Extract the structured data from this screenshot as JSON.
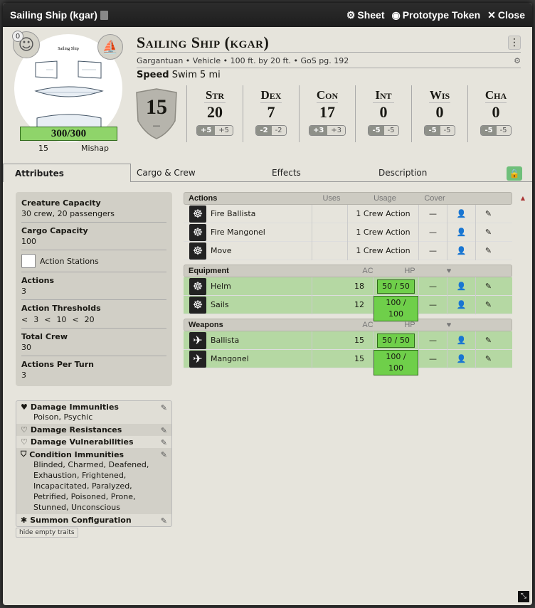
{
  "window": {
    "title": "Sailing Ship (kgar)",
    "sheet": "Sheet",
    "prototype": "Prototype Token",
    "close": "Close"
  },
  "portrait": {
    "token_count": "0",
    "hp": "300/300",
    "hp_sub": "15",
    "mishap": "Mishap",
    "plan_title": "Sailing Ship"
  },
  "header": {
    "name": "Sailing Ship (kgar)",
    "subtitle": "Gargantuan • Vehicle • 100 ft. by 20 ft. • GoS pg. 192",
    "speed_label": "Speed",
    "speed_value": "Swim 5 mi",
    "ac": "15",
    "ac_sub": "—"
  },
  "abilities": [
    {
      "abbr": "Str",
      "score": "20",
      "mod": "+5",
      "save": "+5"
    },
    {
      "abbr": "Dex",
      "score": "7",
      "mod": "-2",
      "save": "-2"
    },
    {
      "abbr": "Con",
      "score": "17",
      "mod": "+3",
      "save": "+3"
    },
    {
      "abbr": "Int",
      "score": "0",
      "mod": "-5",
      "save": "-5"
    },
    {
      "abbr": "Wis",
      "score": "0",
      "mod": "-5",
      "save": "-5"
    },
    {
      "abbr": "Cha",
      "score": "0",
      "mod": "-5",
      "save": "-5"
    }
  ],
  "tabs": [
    "Attributes",
    "Cargo & Crew",
    "Effects",
    "Description"
  ],
  "attributes": {
    "creature_capacity_label": "Creature Capacity",
    "creature_capacity": "30 crew, 20 passengers",
    "cargo_capacity_label": "Cargo Capacity",
    "cargo_capacity": "100",
    "action_stations": "Action Stations",
    "actions_label": "Actions",
    "actions": "3",
    "thresholds_label": "Action Thresholds",
    "thresholds": [
      "<",
      "3",
      "<",
      "10",
      "<",
      "20"
    ],
    "total_crew_label": "Total Crew",
    "total_crew": "30",
    "actions_per_turn_label": "Actions Per Turn",
    "actions_per_turn": "3"
  },
  "traits": [
    {
      "label": "Damage Immunities",
      "value": "Poison, Psychic"
    },
    {
      "label": "Damage Resistances",
      "value": ""
    },
    {
      "label": "Damage Vulnerabilities",
      "value": ""
    },
    {
      "label": "Condition Immunities",
      "value": "Blinded, Charmed, Deafened, Exhaustion, Frightened, Incapacitated, Paralyzed, Petrified, Poisoned, Prone, Stunned, Unconscious"
    },
    {
      "label": "Summon Configuration",
      "value": ""
    }
  ],
  "hide_empty": "hide empty traits",
  "actions_section": {
    "title": "Actions",
    "cols": [
      "Uses",
      "Usage",
      "Cover"
    ],
    "rows": [
      {
        "name": "Fire Ballista",
        "usage": "1 Crew Action",
        "cover": "—"
      },
      {
        "name": "Fire Mangonel",
        "usage": "1 Crew Action",
        "cover": "—"
      },
      {
        "name": "Move",
        "usage": "1 Crew Action",
        "cover": "—"
      }
    ]
  },
  "equipment_section": {
    "title": "Equipment",
    "cols": [
      "AC",
      "HP",
      "♥"
    ],
    "rows": [
      {
        "name": "Helm",
        "ac": "18",
        "hp": "50 / 50",
        "dash": "—"
      },
      {
        "name": "Sails",
        "ac": "12",
        "hp": "100 / 100",
        "dash": "—"
      }
    ]
  },
  "weapons_section": {
    "title": "Weapons",
    "cols": [
      "AC",
      "HP",
      "♥"
    ],
    "rows": [
      {
        "name": "Ballista",
        "ac": "15",
        "hp": "50 / 50",
        "dash": "—"
      },
      {
        "name": "Mangonel",
        "ac": "15",
        "hp": "100 / 100",
        "dash": "—"
      }
    ]
  }
}
